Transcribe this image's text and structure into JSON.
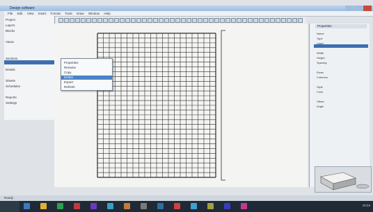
{
  "window": {
    "title": "Design software",
    "controls": [
      "minimize",
      "maximize",
      "close"
    ]
  },
  "menubar": {
    "items": [
      "File",
      "Edit",
      "View",
      "Insert",
      "Format",
      "Tools",
      "Draw",
      "Window",
      "Help"
    ]
  },
  "left_panel": {
    "items": [
      "Project",
      "Layers",
      "Blocks",
      "",
      "Views",
      "",
      "",
      "Sections",
      "",
      "Details",
      "",
      "Sheets",
      "Schedules",
      "",
      "Reports",
      "Settings"
    ]
  },
  "popup_menu": {
    "items": [
      "Properties",
      "Rename",
      "Copy",
      "Delete",
      "Export",
      "Refresh"
    ],
    "selected_index": 3
  },
  "right_panel": {
    "title": "Properties",
    "lines": [
      "Name",
      "Type",
      "Layer",
      "",
      "Width",
      "Height",
      "Spacing",
      "",
      "Rows",
      "Columns",
      "",
      "Style",
      "Color",
      "",
      "Offset",
      "Angle"
    ]
  },
  "statusbar": {
    "text": "Ready"
  },
  "taskbar": {
    "icon_colors": [
      "#3a78c2",
      "#e0b030",
      "#2e9e4a",
      "#c23a3a",
      "#6a3ac2",
      "#3a9ec2",
      "#c27a3a",
      "#7a7a7a",
      "#2e6e9e",
      "#d04040",
      "#40a0d0",
      "#a0a040",
      "#3a3ac2",
      "#c23a8a"
    ],
    "clock": "10:24"
  },
  "colors": {
    "accent": "#3d6fb0",
    "grid": "#2b2b2b"
  }
}
